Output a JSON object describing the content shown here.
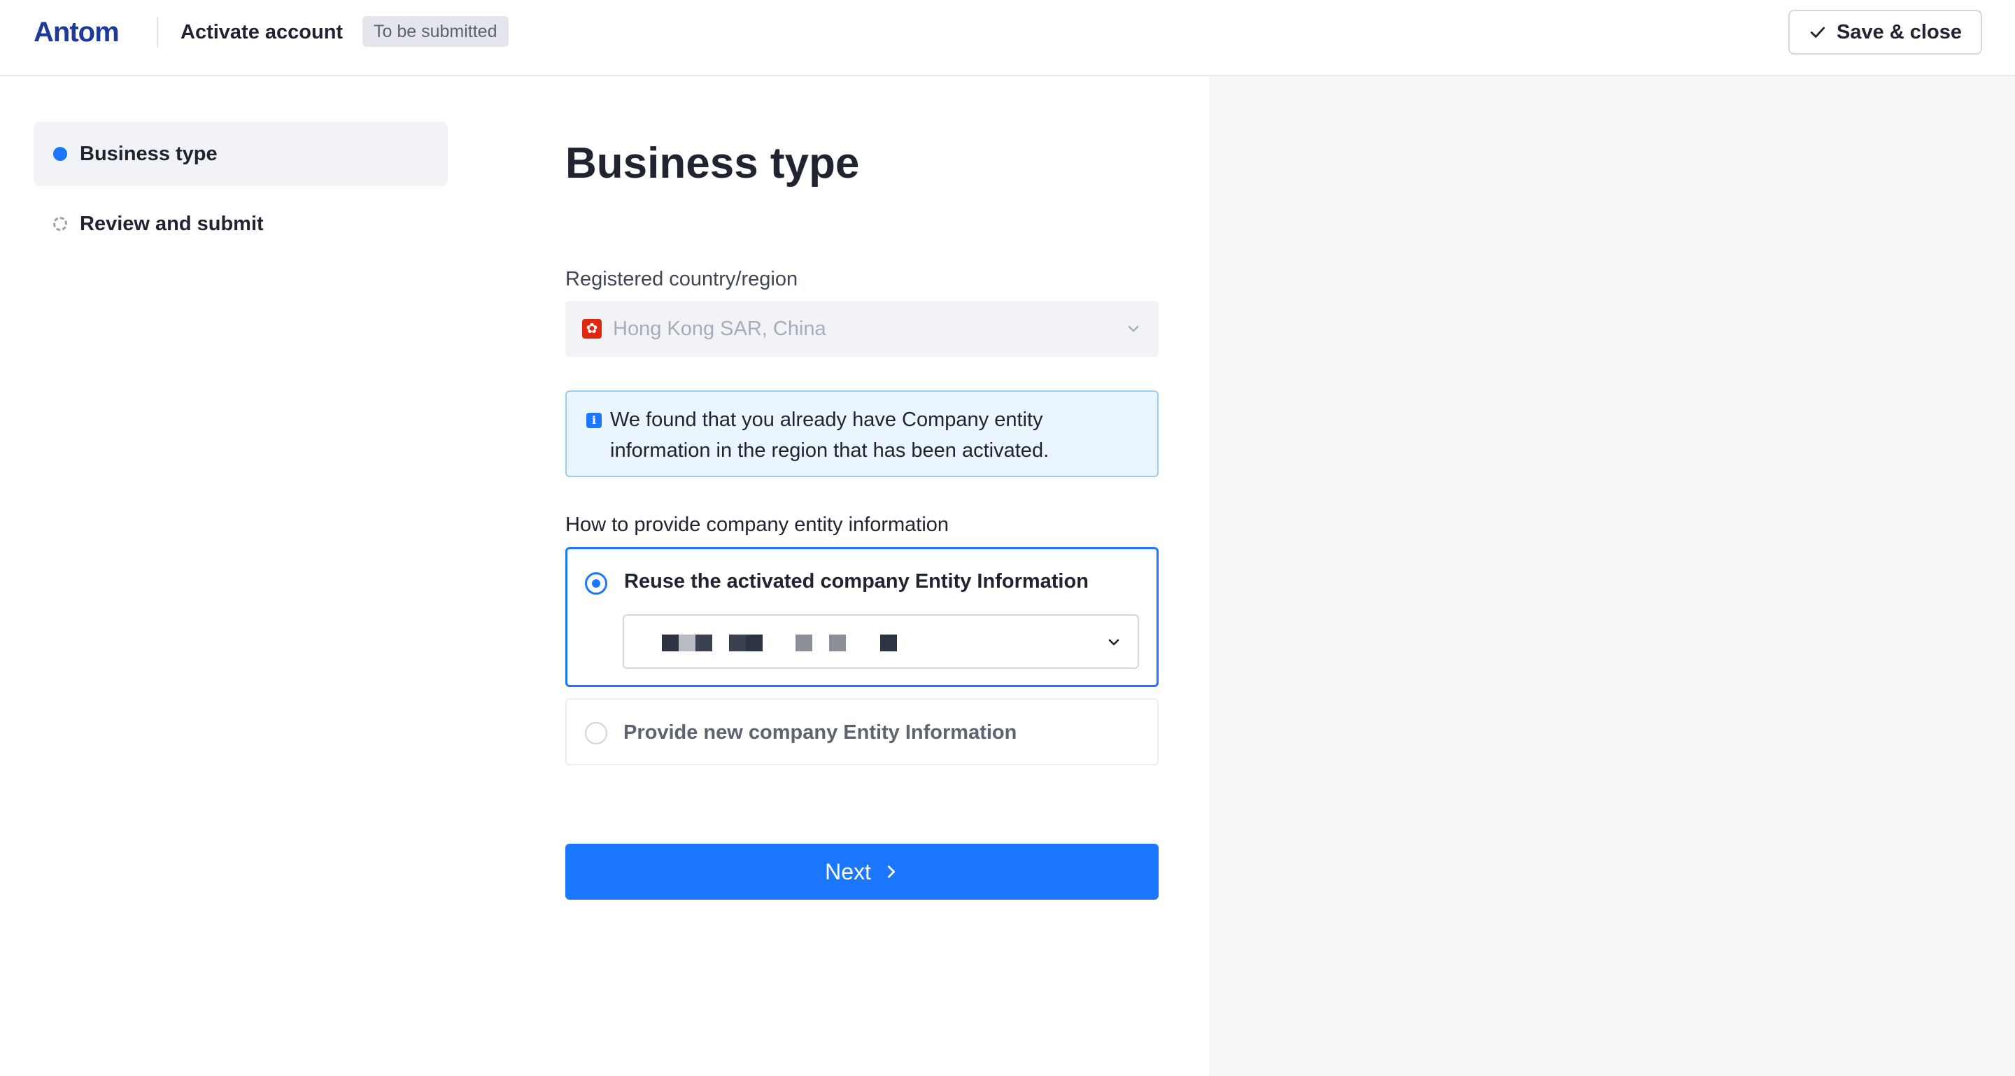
{
  "header": {
    "logo_text": "Antom",
    "title": "Activate account",
    "status_badge": "To be submitted",
    "save_close_label": "Save & close"
  },
  "steps": [
    {
      "label": "Business type",
      "state": "active"
    },
    {
      "label": "Review and submit",
      "state": "pending"
    }
  ],
  "form": {
    "title": "Business type",
    "country_label": "Registered country/region",
    "country_value": "Hong Kong SAR, China",
    "info_message": "We found that you already have Company entity information in the region that has been activated.",
    "entity_question": "How to provide company entity information",
    "options": [
      {
        "label": "Reuse the activated company Entity Information",
        "selected": true
      },
      {
        "label": "Provide new company Entity Information",
        "selected": false
      }
    ],
    "next_label": "Next"
  },
  "colors": {
    "accent": "#1b77ff",
    "info_bg": "#eaf5fe",
    "info_border": "#9ccdf7",
    "brand": "#1d3a9b"
  }
}
